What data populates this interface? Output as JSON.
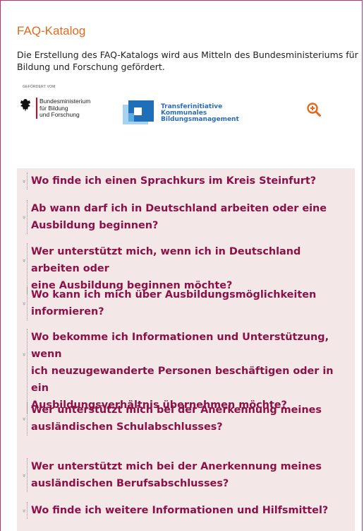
{
  "title": "FAQ-Katalog",
  "intro": "Die Erstellung des FAQ-Katalogs wird aus Mitteln des Bundesministeriums für Bildung und Forschung gefördert.",
  "logos": {
    "bmbf_small": "GEFÖRDERT VOM",
    "bmbf_line1": "Bundesministerium",
    "bmbf_line2": "für Bildung",
    "bmbf_line3": "und Forschung",
    "tk_line1": "Transferinitiative",
    "tk_line2": "Kommunales",
    "tk_line3": "Bildungsmanagement",
    "zoom_icon": "zoom-in-icon"
  },
  "colors": {
    "accent": "#e06a1f",
    "question": "#8b1147",
    "panel": "#f3e7e7",
    "frame": "#b03a6e"
  },
  "faq": [
    {
      "line1": "Wo finde ich einen Sprachkurs im Kreis Steinfurt?"
    },
    {
      "line1": "Ab wann darf ich in Deutschland arbeiten oder eine",
      "line2": "Ausbildung beginnen?"
    },
    {
      "line1": "Wer unterstützt mich, wenn ich in Deutschland arbeiten oder",
      "line2": "eine Ausbildung beginnen möchte?"
    },
    {
      "line1": "Wo kann ich mich über Ausbildungsmöglichkeiten",
      "line2": "informieren?"
    },
    {
      "line1": "Wo bekomme ich Informationen und Unterstützung, wenn",
      "line2": "ich neuzugewanderte Personen beschäftigen oder in ein",
      "line3": "Ausbildungsverhältnis übernehmen möchte?"
    },
    {
      "line1": "Wer unterstützt mich bei der Anerkennung meines",
      "line2": "ausländischen Schulabschlusses?"
    },
    {
      "line1": "Wer unterstützt mich bei der Anerkennung meines",
      "line2": "ausländischen Berufsabschlusses?"
    },
    {
      "line1": "Wo finde ich weitere Informationen und Hilfsmittel?"
    }
  ]
}
